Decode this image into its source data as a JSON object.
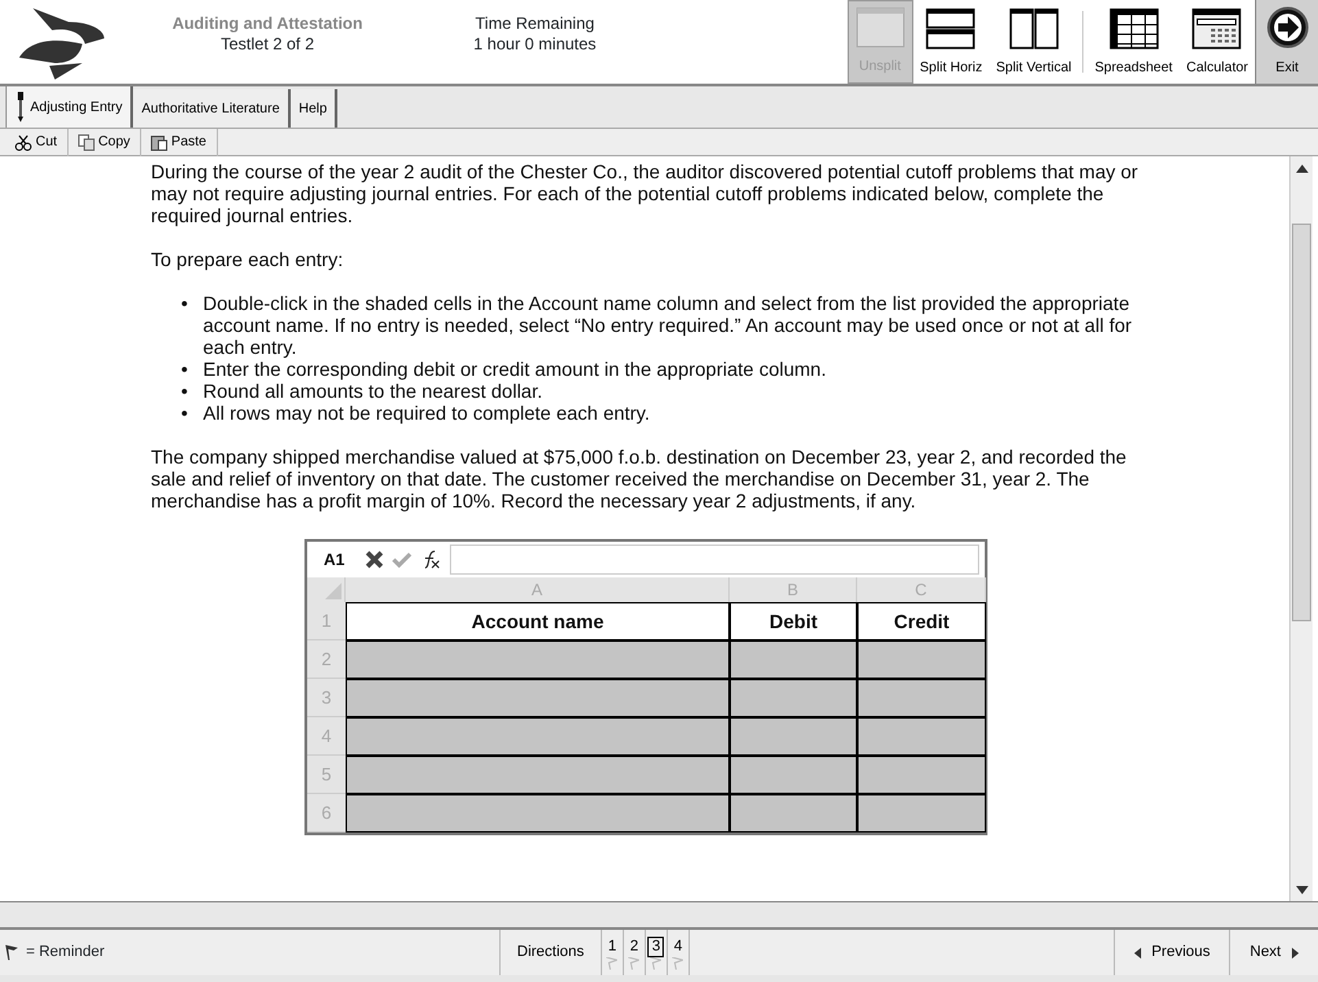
{
  "header": {
    "exam_title": "Auditing and Attestation",
    "testlet": "Testlet 2 of 2",
    "time_label": "Time Remaining",
    "time_value": "1 hour 0 minutes",
    "tools": [
      {
        "label": "Unsplit",
        "kind": "unsplit",
        "disabled": true
      },
      {
        "label": "Split Horiz",
        "kind": "horiz",
        "disabled": false
      },
      {
        "label": "Split Vertical",
        "kind": "vert",
        "disabled": false
      },
      {
        "label": "Spreadsheet",
        "kind": "sheet",
        "disabled": false
      },
      {
        "label": "Calculator",
        "kind": "calc",
        "disabled": false
      }
    ],
    "exit": "Exit"
  },
  "tabs": [
    {
      "label": "Adjusting Entry",
      "selected": true
    },
    {
      "label": "Authoritative Literature",
      "selected": false
    },
    {
      "label": "Help",
      "selected": false
    }
  ],
  "edit_toolbar": [
    {
      "label": "Cut",
      "kind": "cut"
    },
    {
      "label": "Copy",
      "kind": "copy"
    },
    {
      "label": "Paste",
      "kind": "paste"
    }
  ],
  "content": {
    "intro": "During the course of the year 2 audit of the Chester Co., the auditor discovered potential cutoff problems that may or may not require adjusting journal entries. For each of the potential cutoff problems indicated below, complete the required journal entries.",
    "prepare_label": "To prepare each entry:",
    "bullet": "•",
    "bullets": [
      "Double-click in the shaded cells in the Account name column and select from the list provided the appropriate account name. If no entry is needed, select “No entry required.” An account may be used once or not at all for each entry.",
      "Enter the corresponding debit or credit amount in the appropriate column.",
      "Round all amounts to the nearest dollar.",
      "All rows may not be required to complete each entry."
    ],
    "scenario": "The company shipped merchandise valued at $75,000 f.o.b. destination on December 23, year 2, and recorded the sale and relief of inventory on that date. The customer received the merchandise on December 31, year 2. The merchandise has a profit margin of 10%. Record the necessary year 2 adjustments, if any."
  },
  "spreadsheet": {
    "cell_ref": "A1",
    "columns": [
      "A",
      "B",
      "C"
    ],
    "rows": [
      {
        "number": "1",
        "kind": "header",
        "cells": [
          "Account name",
          "Debit",
          "Credit"
        ]
      },
      {
        "number": "2",
        "kind": "entry"
      },
      {
        "number": "3",
        "kind": "entry"
      },
      {
        "number": "4",
        "kind": "entry"
      },
      {
        "number": "5",
        "kind": "entry"
      },
      {
        "number": "6",
        "kind": "entry"
      }
    ]
  },
  "footer": {
    "reminder_label": "= Reminder",
    "directions": "Directions",
    "pages": [
      {
        "label": "1",
        "selected": false
      },
      {
        "label": "2",
        "selected": false
      },
      {
        "label": "3",
        "selected": true
      },
      {
        "label": "4",
        "selected": false
      }
    ],
    "previous": "Previous",
    "next": "Next"
  }
}
